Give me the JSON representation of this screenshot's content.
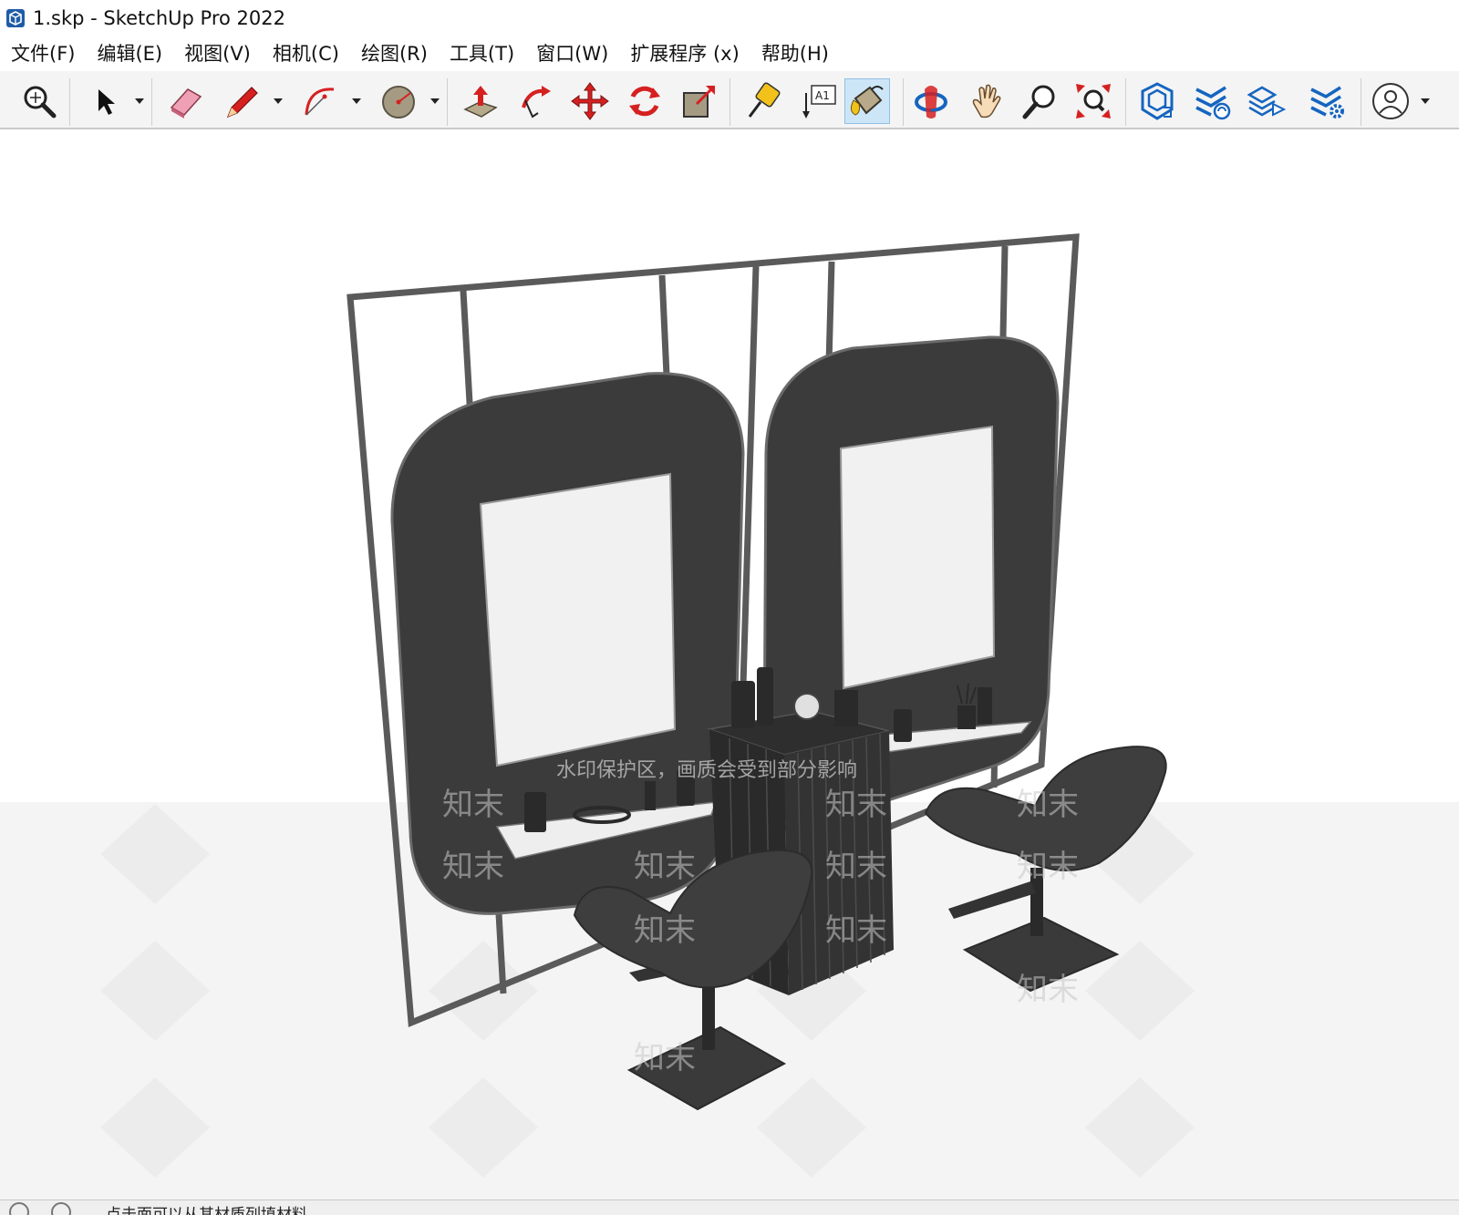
{
  "window": {
    "title": "1.skp - SketchUp Pro 2022"
  },
  "menu": {
    "items": [
      "文件(F)",
      "编辑(E)",
      "视图(V)",
      "相机(C)",
      "绘图(R)",
      "工具(T)",
      "窗口(W)",
      "扩展程序 (x)",
      "帮助(H)"
    ]
  },
  "toolbar": {
    "tools": [
      {
        "icon": "zoom-extents-icon",
        "label": "Zoom Extents"
      },
      {
        "icon": "select-icon",
        "label": "Select"
      },
      {
        "icon": "eraser-icon",
        "label": "Eraser"
      },
      {
        "icon": "pencil-line-icon",
        "label": "Line"
      },
      {
        "icon": "arc-icon",
        "label": "Arc"
      },
      {
        "icon": "circle-icon",
        "label": "Circle"
      },
      {
        "icon": "push-pull-icon",
        "label": "Push/Pull"
      },
      {
        "icon": "follow-me-icon",
        "label": "Follow Me"
      },
      {
        "icon": "move-icon",
        "label": "Move"
      },
      {
        "icon": "rotate-icon",
        "label": "Rotate"
      },
      {
        "icon": "scale-icon",
        "label": "Scale"
      },
      {
        "icon": "tape-measure-icon",
        "label": "Tape Measure"
      },
      {
        "icon": "text-icon",
        "label": "Text"
      },
      {
        "icon": "paint-bucket-icon",
        "label": "Paint Bucket"
      },
      {
        "icon": "orbit-icon",
        "label": "Orbit"
      },
      {
        "icon": "pan-icon",
        "label": "Pan"
      },
      {
        "icon": "zoom-icon",
        "label": "Zoom"
      },
      {
        "icon": "zoom-window-icon",
        "label": "Zoom Extents"
      },
      {
        "icon": "warehouse-icon",
        "label": "3D Warehouse"
      },
      {
        "icon": "extension-warehouse-icon",
        "label": "Extension Warehouse"
      },
      {
        "icon": "layout-send-icon",
        "label": "Send to LayOut"
      },
      {
        "icon": "extension-manager-icon",
        "label": "Extension Manager"
      },
      {
        "icon": "account-icon",
        "label": "Account"
      }
    ],
    "active_tool": "Paint Bucket"
  },
  "viewport": {
    "watermark_banner": "水印保护区，画质会受到部分影响",
    "watermark_brand": "知末"
  },
  "status": {
    "text": "点击面可以从其材质列填材料"
  },
  "colors": {
    "frame": "#595959",
    "panel": "#3a3a3a",
    "mirror": "#f1f1f1",
    "ground": "#f4f4f4",
    "chair": "#3c3c3c",
    "toolbar_bg": "#f4f4f4",
    "active_tool_bg": "#cde6f7",
    "icon_red": "#d62020",
    "icon_blue": "#1565c0"
  }
}
